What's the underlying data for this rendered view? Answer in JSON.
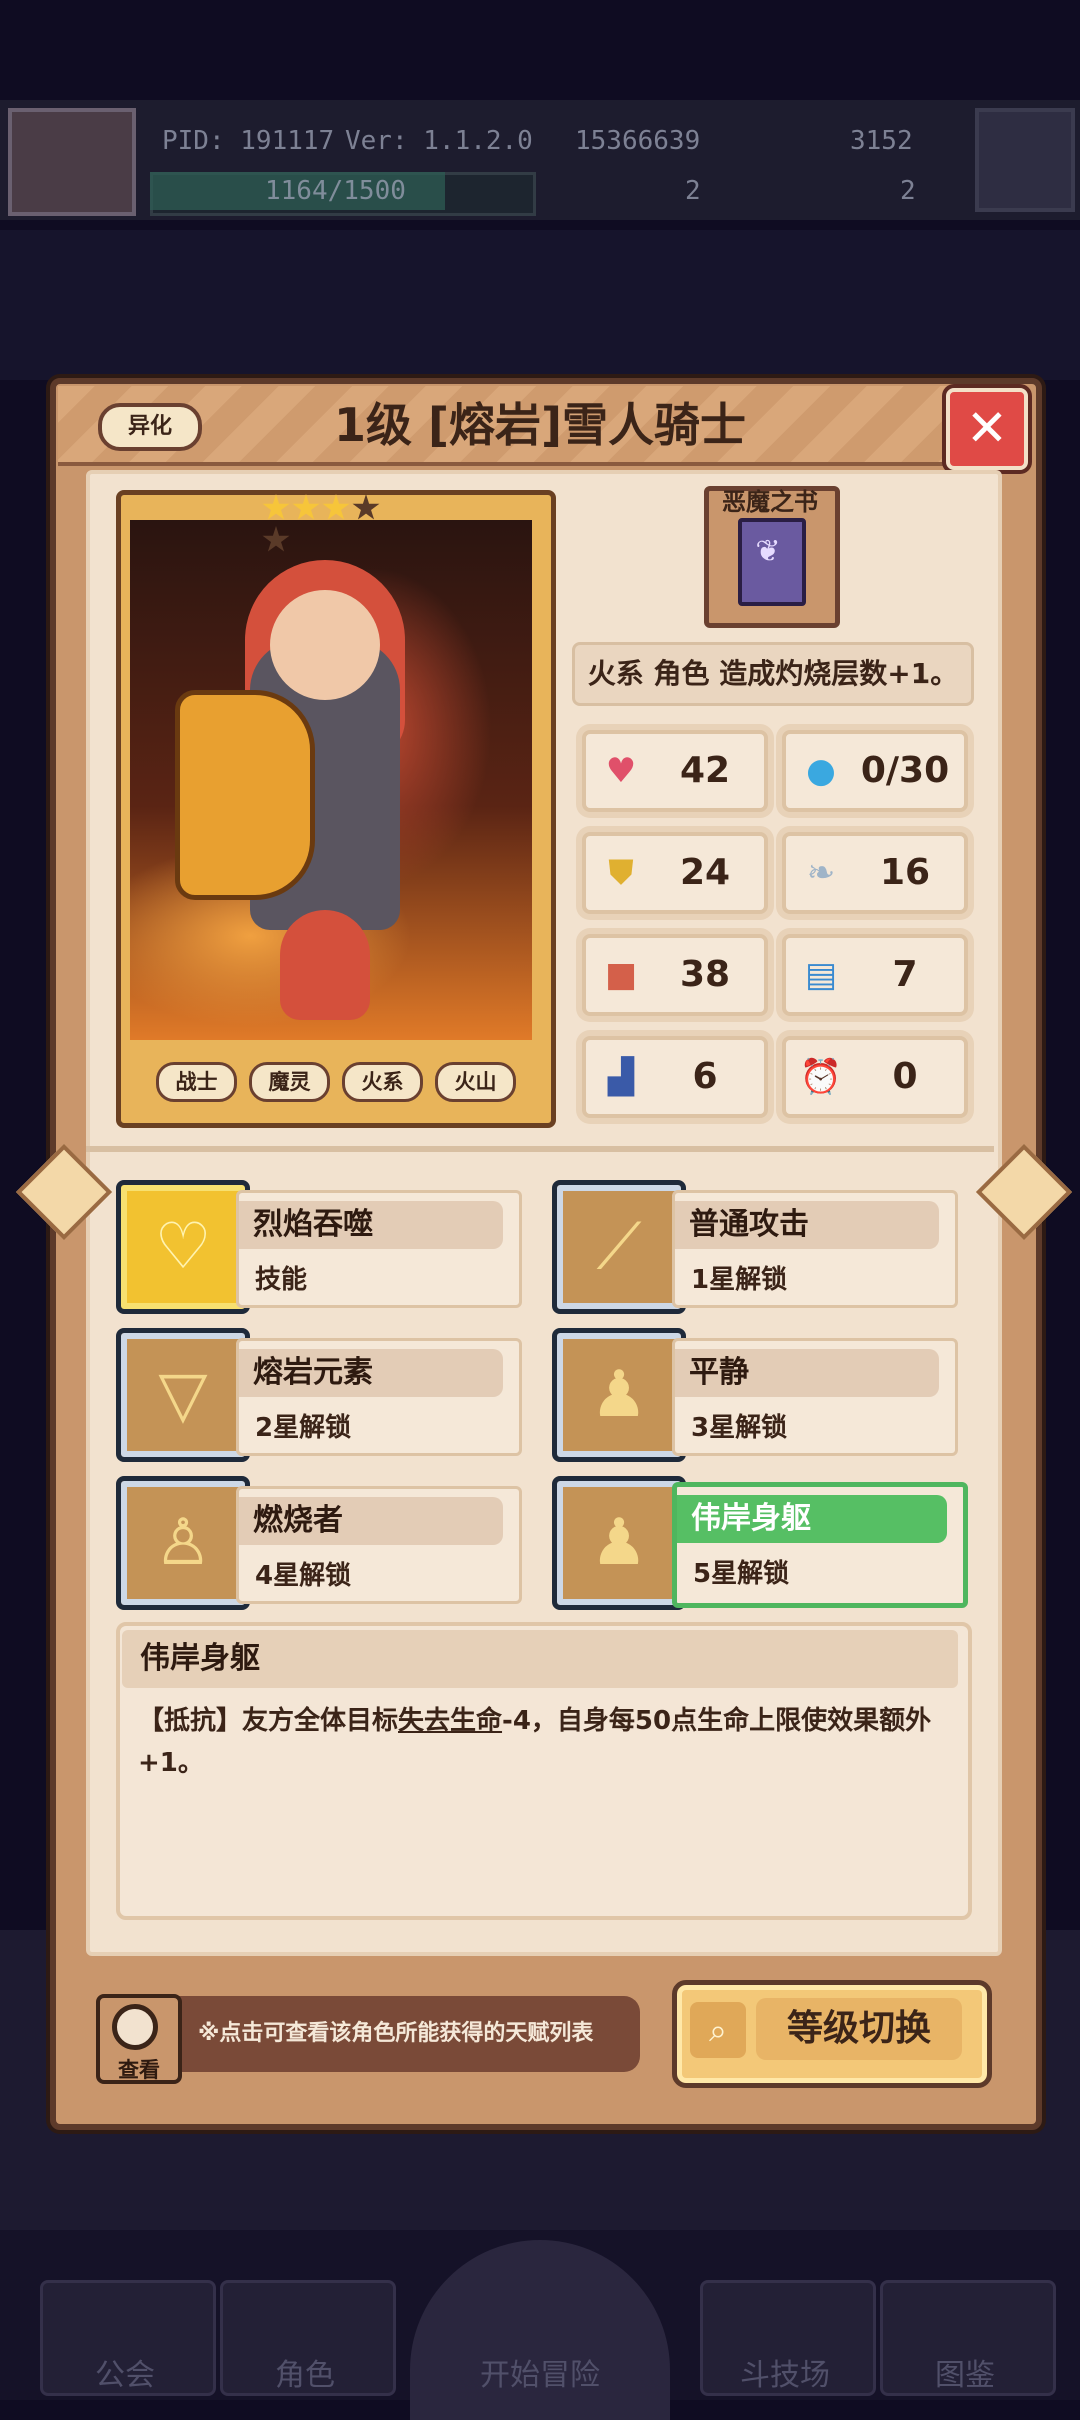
{
  "hud": {
    "pid": "PID: 191117",
    "version": "Ver: 1.1.2.0",
    "gold": "15366639",
    "gems": "3152",
    "energy": "1164/1500",
    "energy_ratio": 0.776,
    "count_a": "2",
    "count_b": "2"
  },
  "bottom_nav": [
    "公会",
    "角色",
    "开始冒险",
    "斗技场",
    "图鉴"
  ],
  "dialog": {
    "badge": "异化",
    "title": "1级 [熔岩]雪人骑士",
    "close_icon": "close-x-icon",
    "stars_filled": 3,
    "stars_total": 5,
    "tags": [
      "战士",
      "魔灵",
      "火系",
      "火山"
    ],
    "equip_name": "恶魔之书",
    "equip_desc": "火系 角色 造成灼烧层数+1。",
    "stats": [
      {
        "icon": "heart-icon",
        "value": "42"
      },
      {
        "icon": "water-drop-icon",
        "value": "0/30"
      },
      {
        "icon": "shield-icon",
        "value": "24"
      },
      {
        "icon": "wing-icon",
        "value": "16"
      },
      {
        "icon": "fist-icon",
        "value": "38"
      },
      {
        "icon": "book-icon",
        "value": "7"
      },
      {
        "icon": "boot-icon",
        "value": "6"
      },
      {
        "icon": "alarm-clock-icon",
        "value": "0"
      }
    ],
    "skills": [
      {
        "name": "烈焰吞噬",
        "sub": "技能",
        "icon": "heart-crest-icon"
      },
      {
        "name": "普通攻击",
        "sub": "1星解锁",
        "icon": "sword-icon"
      },
      {
        "name": "熔岩元素",
        "sub": "2星解锁",
        "icon": "triangle-rune-icon"
      },
      {
        "name": "平静",
        "sub": "3星解锁",
        "icon": "figure-icon"
      },
      {
        "name": "燃烧者",
        "sub": "4星解锁",
        "icon": "spark-figure-icon"
      },
      {
        "name": "伟岸身躯",
        "sub": "5星解锁",
        "icon": "figure-icon"
      }
    ],
    "detail": {
      "title": "伟岸身躯",
      "text_before": "【抵抗】友方全体目标",
      "text_underline": "失去生命",
      "text_after": "-4，自身每50点生命上限使效果额外+1。"
    },
    "view_label": "查看",
    "footer_note": "※点击可查看该角色所能获得的天赋列表",
    "level_switch": "等级切换"
  }
}
